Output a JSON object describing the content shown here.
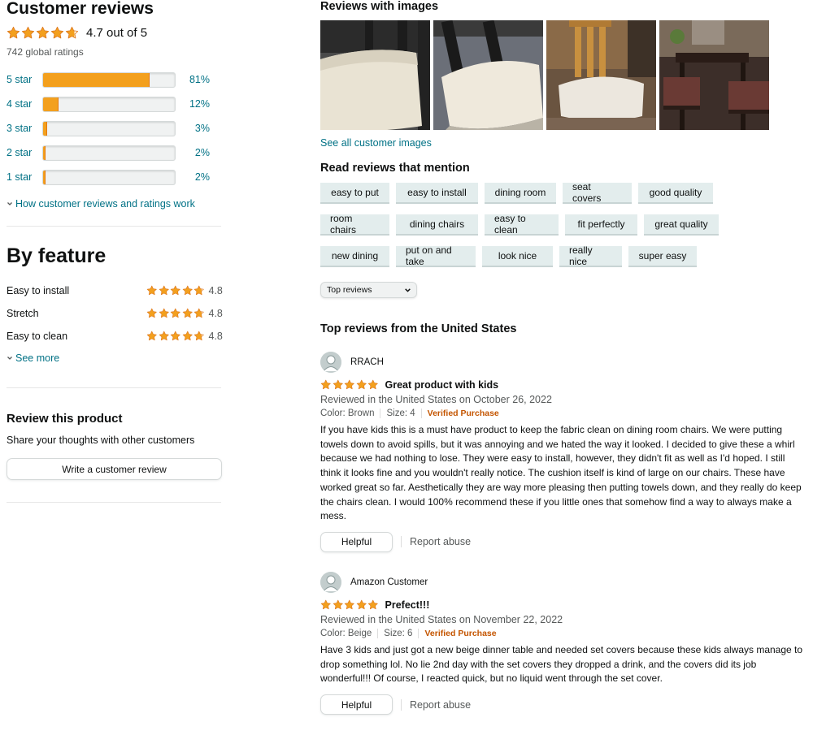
{
  "colors": {
    "star": "#f3a01e",
    "link": "#007185",
    "verified": "#c45500",
    "chip_bg": "#e3eded"
  },
  "summary": {
    "title": "Customer reviews",
    "rating_text": "4.7 out of 5",
    "rating_value": 4.7,
    "global_ratings": "742 global ratings",
    "histogram": [
      {
        "label": "5 star",
        "pct": "81%",
        "fill": 0.81
      },
      {
        "label": "4 star",
        "pct": "12%",
        "fill": 0.12
      },
      {
        "label": "3 star",
        "pct": "3%",
        "fill": 0.03
      },
      {
        "label": "2 star",
        "pct": "2%",
        "fill": 0.02
      },
      {
        "label": "1 star",
        "pct": "2%",
        "fill": 0.02
      }
    ],
    "how_link": "How customer reviews and ratings work"
  },
  "by_feature": {
    "title": "By feature",
    "features": [
      {
        "name": "Easy to install",
        "value": "4.8"
      },
      {
        "name": "Stretch",
        "value": "4.8"
      },
      {
        "name": "Easy to clean",
        "value": "4.8"
      }
    ],
    "see_more": "See more"
  },
  "review_product": {
    "title": "Review this product",
    "subtitle": "Share your thoughts with other customers",
    "button": "Write a customer review"
  },
  "images_section": {
    "title": "Reviews with images",
    "see_all": "See all customer images"
  },
  "mentions": {
    "title": "Read reviews that mention",
    "rows": [
      [
        "easy to put",
        "easy to install",
        "dining room",
        "seat covers",
        "good quality"
      ],
      [
        "room chairs",
        "dining chairs",
        "easy to clean",
        "fit perfectly",
        "great quality"
      ],
      [
        "new dining",
        "put on and take",
        "look nice",
        "really nice",
        "super easy"
      ]
    ]
  },
  "sort": {
    "selected": "Top reviews"
  },
  "top_reviews": {
    "title": "Top reviews from the United States",
    "reviews": [
      {
        "author": "RRACH",
        "stars": 5,
        "title": "Great product with kids",
        "date": "Reviewed in the United States on October 26, 2022",
        "color": "Color: Brown",
        "size": "Size: 4",
        "verified": "Verified Purchase",
        "body": "If you have kids this is a must have product to keep the fabric clean on dining room chairs. We were putting towels down to avoid spills, but it was annoying and we hated the way it looked. I decided to give these a whirl because we had nothing to lose. They were easy to install, however, they didn't fit as well as I'd hoped. I still think it looks fine and you wouldn't really notice. The cushion itself is kind of large on our chairs. These have worked great so far. Aesthetically they are way more pleasing then putting towels down, and they really do keep the chairs clean. I would 100% recommend these if you little ones that somehow find a way to always make a mess.",
        "helpful": "Helpful",
        "report": "Report abuse"
      },
      {
        "author": "Amazon Customer",
        "stars": 5,
        "title": "Prefect!!!",
        "date": "Reviewed in the United States on November 22, 2022",
        "color": "Color: Beige",
        "size": "Size: 6",
        "verified": "Verified Purchase",
        "body": "Have 3 kids and just got a new beige dinner table and needed set covers because these kids always manage to drop something lol. No lie 2nd day with the set covers they dropped a drink, and the covers did its job wonderful!!! Of course, I reacted quick, but no liquid went through the set cover.",
        "helpful": "Helpful",
        "report": "Report abuse"
      }
    ]
  }
}
